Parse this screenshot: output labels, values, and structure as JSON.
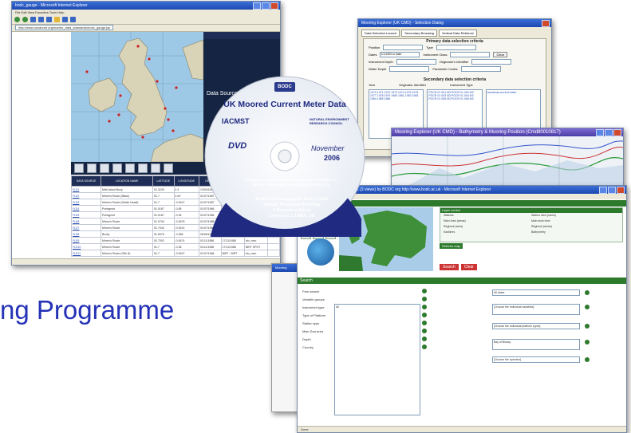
{
  "slide": {
    "title_fragment": "ng Programme"
  },
  "window_main": {
    "title": "bodc_gauge - Microsoft Internet Explorer",
    "menu": "File  Edit  View  Favorites  Tools  Help",
    "address": "http://www.oceannet.org/marine_data_standards/bodc_gauge.jsp",
    "map_bar": "Latitude:  -55° 13' 0\"N          Longitude:  2° 45' 46\"W",
    "panel_label": "Data Source Layers",
    "columns": [
      "DATA SOURCE",
      "LOCATION NAME",
      "LATITUDE",
      "LONGITUDE",
      "DEPTH",
      "DATE",
      "DATE",
      "INFO"
    ],
    "rows": [
      [
        "FLE1",
        "Mist Island Buoy",
        "51.3225",
        "4.3",
        "13/04/1965",
        "15/05/1965",
        "bio_mon"
      ],
      [
        "FLE2",
        "Mimm's Route (Black)",
        "51.7",
        "4.09",
        "01/07/1987",
        "17/11/1987",
        "bio_mon"
      ],
      [
        "FLE3",
        "Mimm's Route (Nimitz Headl)",
        "51.7",
        "-0.5167",
        "01/07/1987",
        "17/11/1987",
        "wear_lab"
      ],
      [
        "FLE4",
        "Portsgrunt",
        "51.0167",
        "-0.85",
        "01/07/1966",
        "17/11/1986",
        "bio_mon"
      ],
      [
        "FLE5",
        "Portsgrunt",
        "51.0167",
        "-0.26",
        "01/07/1966",
        "17/11/1967",
        "BIO 85"
      ],
      [
        "FLE6",
        "Mimm's Route",
        "51.0794",
        "-0.0678",
        "01/07/1988",
        "Rulberra",
        "bio_mon"
      ],
      [
        "FLE7",
        "Mimm's Route",
        "51.7043",
        "-0.5192",
        "01/07/1966",
        "17/11/1981",
        "MO"
      ],
      [
        "FLE8",
        "Brody",
        "51.8476",
        "-0.268",
        "26/06/1977",
        "10/09/1978",
        "bio_mon"
      ],
      [
        "FLE9",
        "Mimm's Route",
        "52.7002",
        "-0.0674",
        "01/11/1986",
        "17/11/1986",
        "bio_mon"
      ],
      [
        "FLE10",
        "Mimm's Route",
        "51.7",
        "-0.28",
        "01/11/1986",
        "17/11/1986",
        "BIRT SPOT"
      ],
      [
        "FLE11",
        "Mimm's Route (Offs H)",
        "51.7",
        "-0.5167",
        "01/07/1966",
        "BIRT - BIRT",
        "bio_mon"
      ]
    ]
  },
  "window_explorer": {
    "title": "Mooring Explorer (UK CMD) - Selection Dialog",
    "tabs": [
      "Data Selection Launch",
      "Secondary Browsing",
      "Vertical Data Retrieval"
    ],
    "primary_header": "Primary data selection criteria",
    "secondary_header": "Secondary data selection criteria",
    "fields": [
      "Position",
      "Dates",
      "Instrument Depth",
      "Water Depth",
      "Type",
      "Instrument Class",
      "Originator's Identifier",
      "Parameter Codes"
    ],
    "dates_value": "1/1/1900 to Date",
    "list_headers": [
      "Year",
      "Originator Identifier",
      "Instrument Type"
    ],
    "list_years": "1970 1971 1972 1973 1974 1975 1976 1977 1978 1979 1980 1981 1982 1983 1984 1985 1986",
    "list_ids": "POCR 01 001 M3 POCR 01 002 M3 POCR 01 003 M3 POCR 01 004 M3 POCR 01 005 M3 POCR 01 006 M3",
    "list_instr": "Aanderaa current meter",
    "go_label": "Clear"
  },
  "window_bathymetry": {
    "title": "Mooring Explorer (UK CMD) - Bathymetry & Mooring Position (Cmd80010817)"
  },
  "window_search": {
    "title": "http://www.sahfos.org - ODIS UK (2 views) by BODC org  http://www.bodc.ac.uk - Microsoft Internet Explorer",
    "tools_header": "Tools",
    "legend_header": "Layer control",
    "legend_items": [
      "Stations",
      "Main Area (areas)",
      "Regional (area)",
      "Eastlines"
    ],
    "legend_items_right": [
      "Station view (name)",
      "Main area view",
      "Regional (areas)",
      "Bathymetry"
    ],
    "refresh_label": "Refresh map",
    "buttons": [
      "Search",
      "Clear"
    ],
    "search_header": "Search",
    "form_labels": [
      "Free search",
      "Variable groups",
      "Instrument type",
      "Type of Platform",
      "Station type",
      "Main Sea area",
      "Depth",
      "Country"
    ],
    "select_value": "All",
    "right_options": [
      "All dates",
      "[Choose the individual variables]",
      "[Choose the individual platform types]",
      "Bay of Biscay",
      "[Choose the operator]"
    ],
    "status": "Done"
  },
  "dvd": {
    "logo": "BODC",
    "title": "UK Moored Current Meter Data",
    "partner_1": "IACMST",
    "partner_2": "NATURAL ENVIRONMENT RESEARCH COUNCIL",
    "format": "DVD",
    "date_month": "November",
    "date_year": "2006",
    "produced_by": "Produced on behalf of the Inter Agency Committee on Marine Science and Technology (IACMST) by",
    "address_1": "British Oceanographic Data Centre",
    "address_2": "Joseph Proudman Building",
    "address_3": "6 Brownlow Street",
    "address_4": "Liverpool, L3 5DA, UK"
  },
  "colors": {
    "title_blue": "#2432b6",
    "dvd_navy": "#1f2a80",
    "search_green": "#2d7a2d"
  }
}
